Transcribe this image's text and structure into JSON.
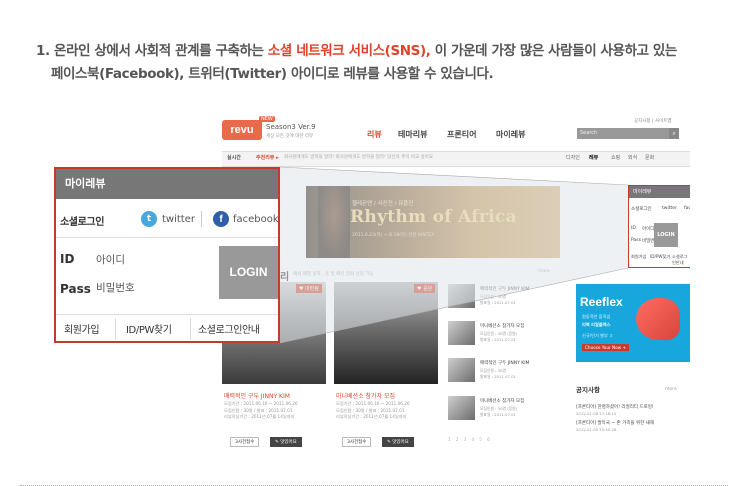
{
  "instruction": {
    "number": "1.",
    "part1": "온라인 상에서 사회적 관계를 구축하는",
    "highlight": "소셜 네트워크 서비스(SNS),",
    "part2": "이 가운데 가장 많은 사람들이 사용하고 있는",
    "line2": "페이스북(Facebook), 트위터(Twitter) 아이디로 레뷰를 사용할 수 있습니다."
  },
  "site": {
    "logo": "revu",
    "badge": "NEW",
    "season": "Season3 Ver.9",
    "season_sub": "세상 모든 것에 대한 리뷰",
    "nav": [
      "리뷰",
      "테마리뷰",
      "프론티어",
      "마이레뷰"
    ],
    "top_links": "공지사항  |  사이트맵",
    "search_placeholder": "Search",
    "search_icon": "magnifier-icon",
    "strip_label": "실시간",
    "strip_hot": "추천리뷰 ▸",
    "strip_text": "회사원에게도 방학을 달라! 회사원에게도 방학을 달라! 당신의 추억 비교 싶어요",
    "strip_menu": [
      "디자인",
      "레뷰",
      "쇼핑",
      "외식",
      "문화"
    ],
    "banner": {
      "subtitle": "헬레몬엔 / 사진전 / 뮤플전",
      "title": "Rhythm of Africa",
      "date": "2011.6.23(목) ~ 8.18(목)  인천 KINTEX"
    },
    "headline_cat": "리",
    "headline_desc": "패셔 패밀 옷차 , 옷 및 패션 잡화 신청 가능",
    "more": "more",
    "cards": [
      {
        "tag": "♥ 마련됨",
        "title": "매력적인 구두 JINNY KIM",
        "meta": [
          "모집기간 : 2011.06.16 ~ 2011.06.26",
          "모집인원 : 30명 / 발표 : 2011.07.01",
          "리뷰작성기간 : 2011년 07월 14일까지"
        ],
        "btn1": "3사건접수",
        "btn2": "✎ 맛있어요"
      },
      {
        "tag": "♥ 응원",
        "title": "미니베션소 참가자 모집",
        "meta": [
          "모집기간 : 2011.06.16 ~ 2011.06.26",
          "모집인원 : 30명 / 발표 : 2011.07.01",
          "리뷰작성기간 : 2011년 07월 14일까지"
        ],
        "btn1": "3사건접수",
        "btn2": "✎ 맛있어요"
      }
    ],
    "thumbs": [
      {
        "title": "매력적인 구두 JINNY KIM",
        "meta": "모집인원 : 30명",
        "meta2": "발표일 : 2011.07.01"
      },
      {
        "title": "미니베션소 참가자 모집",
        "meta": "모집인원 : 30명 (응원)",
        "meta2": "발표일 : 2011.07.01"
      },
      {
        "title": "매력적인 구두 JINNY KIM",
        "meta": "모집인원 : 30명",
        "meta2": "발표일 : 2011.07.01"
      },
      {
        "title": "미니베션소 참가자 모집",
        "meta": "모집인원 : 30명 (응원)",
        "meta2": "발표일 : 2011.07.01"
      }
    ],
    "pager": "1 2 3 4 5 6",
    "small_login": {
      "title": "마이레뷰",
      "social": "소셜로그인",
      "twitter": "twitter",
      "facebook": "facebook",
      "id": "ID",
      "id_val": "아이디",
      "pass": "Pass",
      "pass_val": "비밀번호",
      "login": "LOGIN",
      "foot": [
        "회원가입",
        "ID/PW찾기",
        "소셜로그인안내"
      ]
    },
    "ad": {
      "title": "Reeflex",
      "line1": "원동적인 움직임",
      "line2": "리복 리얼플렉스",
      "line3": "신규/인기 발부 ㅎ",
      "button": "Choose Your Now +"
    },
    "notice": {
      "title": "공지사항",
      "items": [
        {
          "text": "[프론티어] 한명하셨어! 리얼리티 드로잉!",
          "date": "2012-01-06 17:16:15"
        },
        {
          "text": "[프론티어] 발막국 ~ 존 가족을 위한 새해",
          "date": "2012-01-05 15:40:28"
        }
      ]
    }
  },
  "zoom": {
    "title": "마이레뷰",
    "social_label": "소셜로그인",
    "twitter_icon": "t",
    "twitter": "twitter",
    "facebook_icon": "f",
    "facebook": "facebook",
    "id_label": "ID",
    "id_value": "아이디",
    "pass_label": "Pass",
    "pass_value": "비밀번호",
    "login": "LOGIN",
    "footer": [
      "회원가입",
      "ID/PW찾기",
      "소셜로그인안내"
    ]
  },
  "colors": {
    "accent": "#e0432b",
    "frame": "#c63a2a",
    "header": "#777777",
    "twitter": "#48a8dc",
    "facebook": "#2f5fa7"
  }
}
